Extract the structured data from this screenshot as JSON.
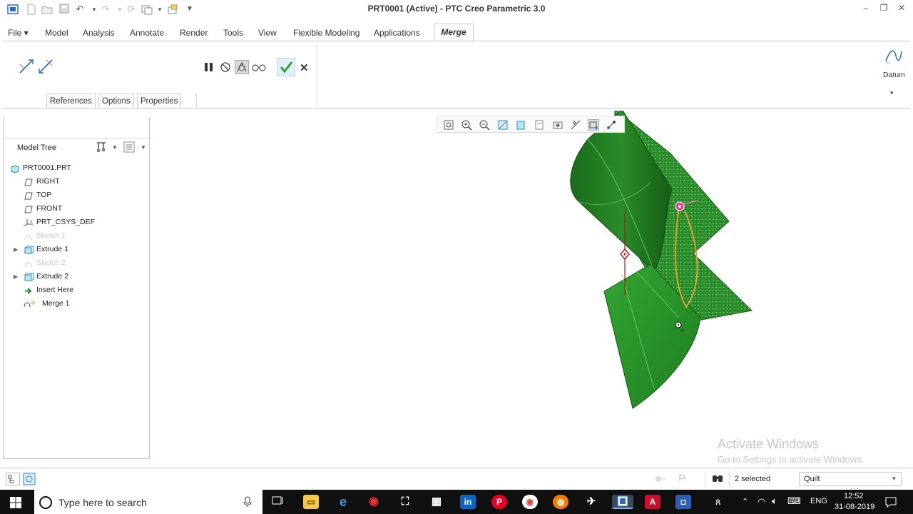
{
  "window": {
    "title": "PRT0001 (Active) - PTC Creo Parametric 3.0"
  },
  "menubar": {
    "items": [
      "File",
      "Model",
      "Analysis",
      "Annotate",
      "Render",
      "Tools",
      "View",
      "Flexible Modeling",
      "Applications",
      "Merge"
    ]
  },
  "ribbon": {
    "tabs": [
      "References",
      "Options",
      "Properties"
    ],
    "datum_label": "Datum"
  },
  "model_tree": {
    "title": "Model Tree",
    "items": [
      {
        "label": "PRT0001.PRT",
        "icon": "part-icon",
        "enabled": true
      },
      {
        "label": "RIGHT",
        "icon": "datum-plane-icon",
        "enabled": true
      },
      {
        "label": "TOP",
        "icon": "datum-plane-icon",
        "enabled": true
      },
      {
        "label": "FRONT",
        "icon": "datum-plane-icon",
        "enabled": true
      },
      {
        "label": "PRT_CSYS_DEF",
        "icon": "csys-icon",
        "enabled": true
      },
      {
        "label": "Sketch 1",
        "icon": "sketch-icon",
        "enabled": false
      },
      {
        "label": "Extrude 1",
        "icon": "extrude-icon",
        "enabled": true
      },
      {
        "label": "Sketch 2",
        "icon": "sketch-icon",
        "enabled": false
      },
      {
        "label": "Extrude 2",
        "icon": "extrude-icon",
        "enabled": true
      },
      {
        "label": "Insert Here",
        "icon": "insert-arrow-icon",
        "enabled": true
      },
      {
        "label": "Merge 1",
        "icon": "merge-icon",
        "enabled": true
      }
    ]
  },
  "status": {
    "selected": "2 selected",
    "filter": "Quilt"
  },
  "watermark": {
    "line1": "Activate Windows",
    "line2": "Go to Settings to activate Windows."
  },
  "taskbar": {
    "search_placeholder": "Type here to search",
    "language": "ENG",
    "time": "12:52",
    "date": "31-08-2019"
  },
  "colors": {
    "surface_dark": "#1d7a1d",
    "surface_mid": "#2e9a2e",
    "selection_pink": "#e83c9a",
    "edge_orange": "#e8a030",
    "accent_green": "#44b544"
  }
}
